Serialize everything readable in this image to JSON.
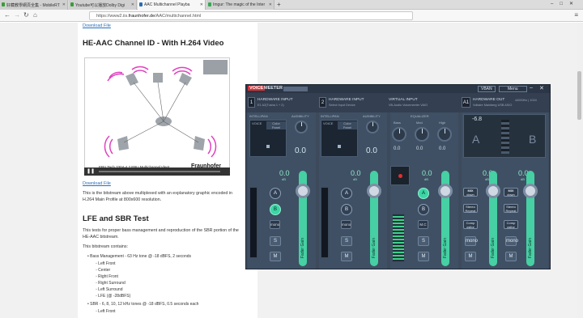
{
  "browser": {
    "tabs": [
      {
        "title": "好藏教學網頁全集 - MobileRT",
        "color": "#3a9d3a"
      },
      {
        "title": "Youtube可以播放Dolby Digi",
        "color": "#3a9d3a"
      },
      {
        "title": "AAC Multichannel Playba",
        "color": "#2b6db3"
      },
      {
        "title": "Imgur: The magic of the Inter",
        "color": "#34a853"
      }
    ],
    "new_tab": "+",
    "url_prefix": "https://www2.iis.",
    "url_domain": "fraunhofer.de",
    "url_suffix": "/AAC/multichannel.html"
  },
  "page": {
    "download1": "Download File",
    "heading1": "HE-AAC Channel ID - With H.264 Video",
    "video_caption": "EBU Tech 3304-4.2 EBU Multichannel Ident",
    "video_logo": "Fraunhofer",
    "download2": "Download File",
    "para1": "This is the bitstream above multiplexed with an explanatory graphic encoded in H.264 Main Profile at 800x600 resolution.",
    "heading2": "LFE and SBR Test",
    "para2": "This tests for proper bass management and reproduction of the SBR portion of the HE-AAC bitstream.",
    "para3": "This bitstream contains:",
    "bullet1": "Bass Management - 63 Hz tone @ -18 dBFS, 2 seconds",
    "sub1": [
      "Left Front",
      "Center",
      "Right Front",
      "Right Surround",
      "Left Surround",
      "LFE (@ -28dBFS)"
    ],
    "bullet2": "SBR - 6, 8, 10, 12 kHz tones @ -18 dBFS, 0.5 seconds each",
    "sub2": [
      "Left Front"
    ]
  },
  "voicemeeter": {
    "logo_a": "VOICE",
    "logo_b": "MEETER",
    "vban": "VBAN",
    "menu": "Menu",
    "hw1_title": "HARDWARE INPUT",
    "hw1_sub": "E1 A2(Tusha 1 + 2)",
    "hw2_title": "HARDWARE INPUT",
    "hw2_sub": "Select Input Device",
    "virt_title": "VIRTUAL INPUT",
    "virt_sub": "VB-Audio Voicemeeter VAIO",
    "hwout_title": "HARDWARE OUT",
    "hwout_rate": "44000Hz | 1024",
    "hwout_sub": "Voltaire Mainberg USB ASIO",
    "intellipan": "INTELLIPAN",
    "audibility": "AUDIBILITY",
    "equalizer": "EQUALIZER",
    "voice": "VOICE",
    "color_panel": "Color Panel",
    "eq_labels": [
      "Bass",
      "Med",
      "High"
    ],
    "zero": "0.0",
    "db_unit": "dB",
    "fader_gain": "Fader Gain",
    "out_db": "-6.8",
    "mono": "mono",
    "solo": "S",
    "mute": "M",
    "mc": "M.C",
    "a_btn": "A",
    "b_btn": "B",
    "mix": "MIX",
    "mix_sub": "down",
    "stereo": "Stereo Repeat",
    "comp": "Comp ositor",
    "channel_nums": [
      "1",
      "2",
      "A1"
    ]
  }
}
